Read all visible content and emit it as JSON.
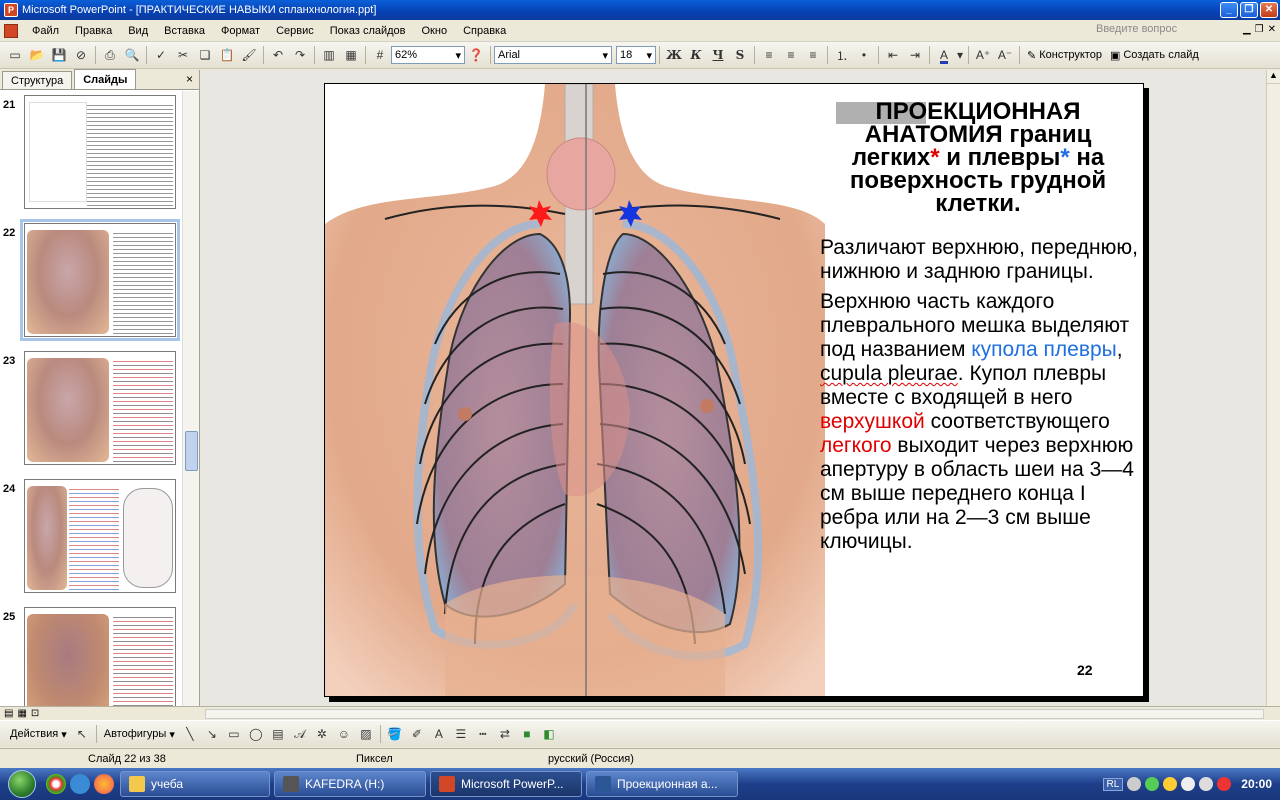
{
  "window": {
    "title": "Microsoft PowerPoint - [ПРАКТИЧЕСКИЕ НАВЫКИ спланхнология.ppt]"
  },
  "menu": {
    "items": [
      "Файл",
      "Правка",
      "Вид",
      "Вставка",
      "Формат",
      "Сервис",
      "Показ слайдов",
      "Окно",
      "Справка"
    ],
    "question_placeholder": "Введите вопрос"
  },
  "toolbar": {
    "zoom": "62%",
    "font": "Arial",
    "font_size": "18",
    "bold_label": "Ж",
    "italic_label": "К",
    "underline_label": "Ч",
    "shadow_label": "S",
    "designer_label": "Конструктор",
    "new_slide_label": "Создать слайд"
  },
  "left_panel": {
    "tabs": [
      "Структура",
      "Слайды"
    ],
    "active_tab": "Слайды",
    "close_label": "×",
    "thumbnails": [
      "21",
      "22",
      "23",
      "24",
      "25"
    ],
    "selected": "22"
  },
  "slide": {
    "title_part1": "ПРОЕКЦИОННАЯ АНАТОМИЯ границ легких",
    "title_star1": "*",
    "title_part2": " и плевры",
    "title_star2": "*",
    "title_part3": " на поверхность грудной клетки.",
    "para1": "Различают верхнюю, переднюю, нижнюю и заднюю границы.",
    "para2_a": "Верхнюю часть каждого плеврального мешка выделяют под названием ",
    "para2_blue": "купола плевры",
    "para2_b": ", ",
    "para2_latin": "cupula pleurae",
    "para2_c": ". Купол плевры вместе с входящей в него ",
    "para2_red1": "верхушкой",
    "para2_d": " соответствующего ",
    "para2_red2": "легкого",
    "para2_e": " выходит через верхнюю апертуру в область шеи на 3—4 см выше переднего конца I ребра или на 2—3 см выше ключицы.",
    "number": "22"
  },
  "drawing_toolbar": {
    "actions_label": "Действия",
    "autoshapes_label": "Автофигуры"
  },
  "status": {
    "slide_info": "Слайд 22 из 38",
    "design": "Пиксел",
    "language": "русский (Россия)"
  },
  "taskbar": {
    "tasks": [
      "учеба",
      "KAFEDRA (H:)",
      "Microsoft PowerP...",
      "Проекционная а..."
    ],
    "lang": "RL",
    "clock": "20:00"
  },
  "colors": {
    "accent_blue": "#1f6fe0",
    "accent_red": "#e00000",
    "marker_red": "#ff1a1a",
    "marker_blue": "#1535e0"
  }
}
